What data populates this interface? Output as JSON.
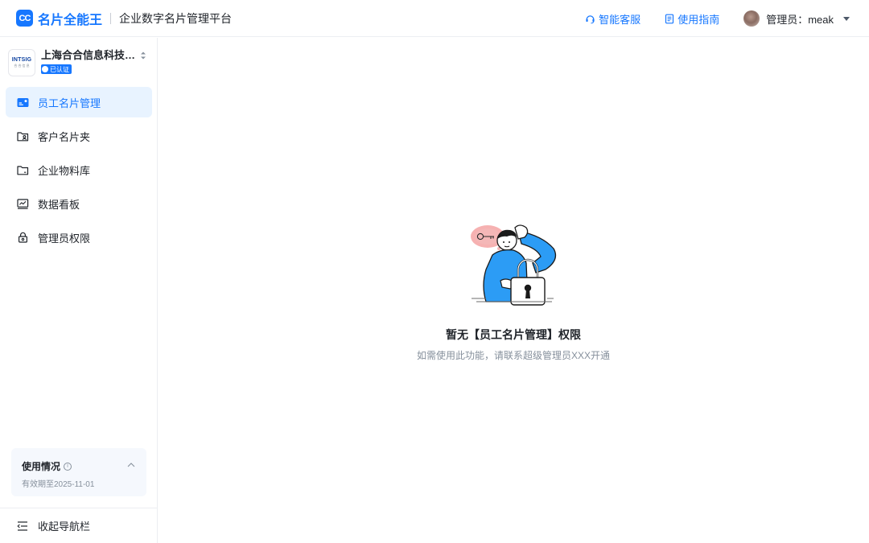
{
  "header": {
    "logo_text": "CC",
    "brand_name": "名片全能王",
    "platform_title": "企业数字名片管理平台",
    "links": [
      {
        "label": "智能客服",
        "icon": "headset-icon"
      },
      {
        "label": "使用指南",
        "icon": "guide-doc-icon"
      }
    ],
    "user": {
      "label": "管理员：meak"
    }
  },
  "sidebar": {
    "org": {
      "logo_line1": "INTSIG",
      "logo_line2": "合 合 信 息",
      "name": "上海合合信息科技股份有限公司",
      "badge": "已认证"
    },
    "items": [
      {
        "label": "员工名片管理",
        "icon": "card-icon",
        "active": true
      },
      {
        "label": "客户名片夹",
        "icon": "contact-folder-icon",
        "active": false
      },
      {
        "label": "企业物料库",
        "icon": "folder-icon",
        "active": false
      },
      {
        "label": "数据看板",
        "icon": "chart-board-icon",
        "active": false
      },
      {
        "label": "管理员权限",
        "icon": "lock-icon",
        "active": false
      }
    ],
    "usage": {
      "title": "使用情况",
      "expiry": "有效期至2025-11-01"
    },
    "collapse_label": "收起导航栏"
  },
  "main": {
    "empty_title": "暂无【员工名片管理】权限",
    "empty_desc": "如需使用此功能，请联系超级管理员XXX开通"
  },
  "colors": {
    "primary": "#1677ff",
    "active_bg": "#e8f3ff",
    "text": "#1f2329",
    "muted": "#86909c",
    "border": "#eceef2"
  }
}
